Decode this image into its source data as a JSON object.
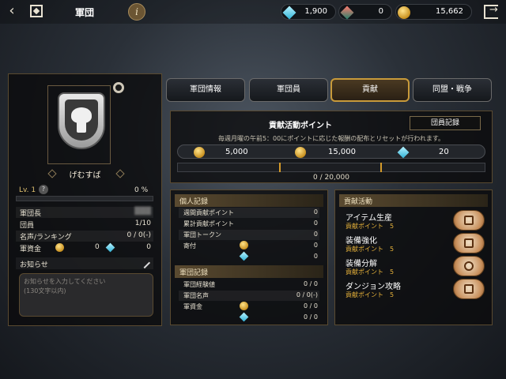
{
  "header": {
    "title": "軍団",
    "info_label": "i",
    "currencies": [
      {
        "icon": "diamond-cyan-icon",
        "value": "1,900"
      },
      {
        "icon": "diamond-red-icon",
        "value": "0"
      },
      {
        "icon": "gold-coin-icon",
        "value": "15,662"
      }
    ]
  },
  "guild": {
    "name": "げむすば",
    "level_label": "Lv. 1",
    "level_help": "?",
    "progress_pct": "0 %",
    "progress_fraction": 0,
    "rows": [
      {
        "key": "軍団長",
        "value": "███"
      },
      {
        "key": "団員",
        "value": "1/10"
      },
      {
        "key": "名声/ランキング",
        "value": "0 / 0(-)"
      },
      {
        "key": "軍資金",
        "value_gold": "0",
        "value_gem": "0"
      }
    ],
    "notice_label": "お知らせ",
    "notice_placeholder": "お知らせを入力してください\n(130文字以内)"
  },
  "tabs": [
    {
      "label": "軍団情報",
      "active": false
    },
    {
      "label": "軍団員",
      "active": false
    },
    {
      "label": "貢献",
      "active": true
    },
    {
      "label": "同盟・戦争",
      "active": false
    }
  ],
  "contribution": {
    "title": "貢献活動ポイント",
    "member_record_button": "団員記録",
    "subtitle": "毎週月曜の午前5：00にポイントに応じた報酬の配布とリセットが行われます。",
    "rewards": [
      {
        "icon": "gold-coin-icon",
        "value": "5,000"
      },
      {
        "icon": "gold-coin-icon",
        "value": "15,000"
      },
      {
        "icon": "diamond-cyan-icon",
        "value": "20"
      }
    ],
    "progress_text": "0 / 20,000",
    "progress_fraction": 0
  },
  "personal_record": {
    "header": "個人記録",
    "rows": [
      {
        "key": "週間貢献ポイント",
        "value": "0"
      },
      {
        "key": "累計貢献ポイント",
        "value": "0"
      },
      {
        "key": "軍団トークン",
        "value": "0"
      },
      {
        "key": "寄付",
        "value": "0"
      },
      {
        "key": "",
        "value": "0"
      }
    ]
  },
  "guild_record": {
    "header": "軍団記録",
    "rows": [
      {
        "key": "軍団経験値",
        "value": "0 / 0"
      },
      {
        "key": "軍団名声",
        "value": "0 / 0(-)"
      },
      {
        "key": "軍資金",
        "value": "0 / 0"
      },
      {
        "key": "",
        "value": "0 / 0"
      }
    ]
  },
  "activities": {
    "header": "貢献活動",
    "items": [
      {
        "name": "アイテム生産",
        "points": "貢献ポイント　5",
        "icon": "hammer-icon"
      },
      {
        "name": "装備強化",
        "points": "貢献ポイント　5",
        "icon": "armor-icon"
      },
      {
        "name": "装備分解",
        "points": "貢献ポイント　5",
        "icon": "disassemble-icon"
      },
      {
        "name": "ダンジョン攻略",
        "points": "貢献ポイント　5",
        "icon": "dungeon-icon"
      }
    ]
  }
}
